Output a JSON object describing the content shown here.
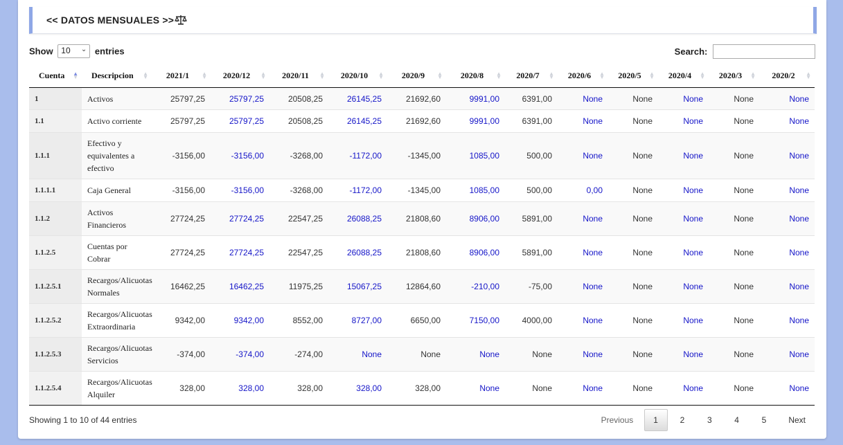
{
  "title": "<< DATOS MENSUALES >>",
  "title_icon": "balance-scale-icon",
  "length": {
    "show_label": "Show",
    "value": "10",
    "entries_label": "entries"
  },
  "search": {
    "label": "Search:",
    "value": ""
  },
  "columns": [
    "Cuenta",
    "Descripcion",
    "2021/1",
    "2020/12",
    "2020/11",
    "2020/10",
    "2020/9",
    "2020/8",
    "2020/7",
    "2020/6",
    "2020/5",
    "2020/4",
    "2020/3",
    "2020/2"
  ],
  "rows": [
    {
      "cuenta": "1",
      "descripcion": "Activos",
      "values": [
        "25797,25",
        "25797,25",
        "20508,25",
        "26145,25",
        "21692,60",
        "9991,00",
        "6391,00",
        "None",
        "None",
        "None",
        "None",
        "None"
      ]
    },
    {
      "cuenta": "1.1",
      "descripcion": "Activo corriente",
      "values": [
        "25797,25",
        "25797,25",
        "20508,25",
        "26145,25",
        "21692,60",
        "9991,00",
        "6391,00",
        "None",
        "None",
        "None",
        "None",
        "None"
      ]
    },
    {
      "cuenta": "1.1.1",
      "descripcion": "Efectivo y equivalentes a efectivo",
      "values": [
        "-3156,00",
        "-3156,00",
        "-3268,00",
        "-1172,00",
        "-1345,00",
        "1085,00",
        "500,00",
        "None",
        "None",
        "None",
        "None",
        "None"
      ]
    },
    {
      "cuenta": "1.1.1.1",
      "descripcion": "Caja General",
      "values": [
        "-3156,00",
        "-3156,00",
        "-3268,00",
        "-1172,00",
        "-1345,00",
        "1085,00",
        "500,00",
        "0,00",
        "None",
        "None",
        "None",
        "None"
      ]
    },
    {
      "cuenta": "1.1.2",
      "descripcion": "Activos Financieros",
      "values": [
        "27724,25",
        "27724,25",
        "22547,25",
        "26088,25",
        "21808,60",
        "8906,00",
        "5891,00",
        "None",
        "None",
        "None",
        "None",
        "None"
      ]
    },
    {
      "cuenta": "1.1.2.5",
      "descripcion": "Cuentas por Cobrar",
      "values": [
        "27724,25",
        "27724,25",
        "22547,25",
        "26088,25",
        "21808,60",
        "8906,00",
        "5891,00",
        "None",
        "None",
        "None",
        "None",
        "None"
      ]
    },
    {
      "cuenta": "1.1.2.5.1",
      "descripcion": "Recargos/Alicuotas Normales",
      "values": [
        "16462,25",
        "16462,25",
        "11975,25",
        "15067,25",
        "12864,60",
        "-210,00",
        "-75,00",
        "None",
        "None",
        "None",
        "None",
        "None"
      ]
    },
    {
      "cuenta": "1.1.2.5.2",
      "descripcion": "Recargos/Alicuotas Extraordinaria",
      "values": [
        "9342,00",
        "9342,00",
        "8552,00",
        "8727,00",
        "6650,00",
        "7150,00",
        "4000,00",
        "None",
        "None",
        "None",
        "None",
        "None"
      ]
    },
    {
      "cuenta": "1.1.2.5.3",
      "descripcion": "Recargos/Alicuotas Servicios",
      "values": [
        "-374,00",
        "-374,00",
        "-274,00",
        "None",
        "None",
        "None",
        "None",
        "None",
        "None",
        "None",
        "None",
        "None"
      ]
    },
    {
      "cuenta": "1.1.2.5.4",
      "descripcion": "Recargos/Alicuotas Alquiler",
      "values": [
        "328,00",
        "328,00",
        "328,00",
        "328,00",
        "328,00",
        "None",
        "None",
        "None",
        "None",
        "None",
        "None",
        "None"
      ]
    }
  ],
  "info": "Showing 1 to 10 of 44 entries",
  "pagination": {
    "previous": "Previous",
    "pages": [
      "1",
      "2",
      "3",
      "4",
      "5"
    ],
    "current": "1",
    "next": "Next"
  },
  "colors": {
    "blue_value": "#1515c8",
    "accent": "#8fa7e6",
    "background": "#a9bdec"
  }
}
